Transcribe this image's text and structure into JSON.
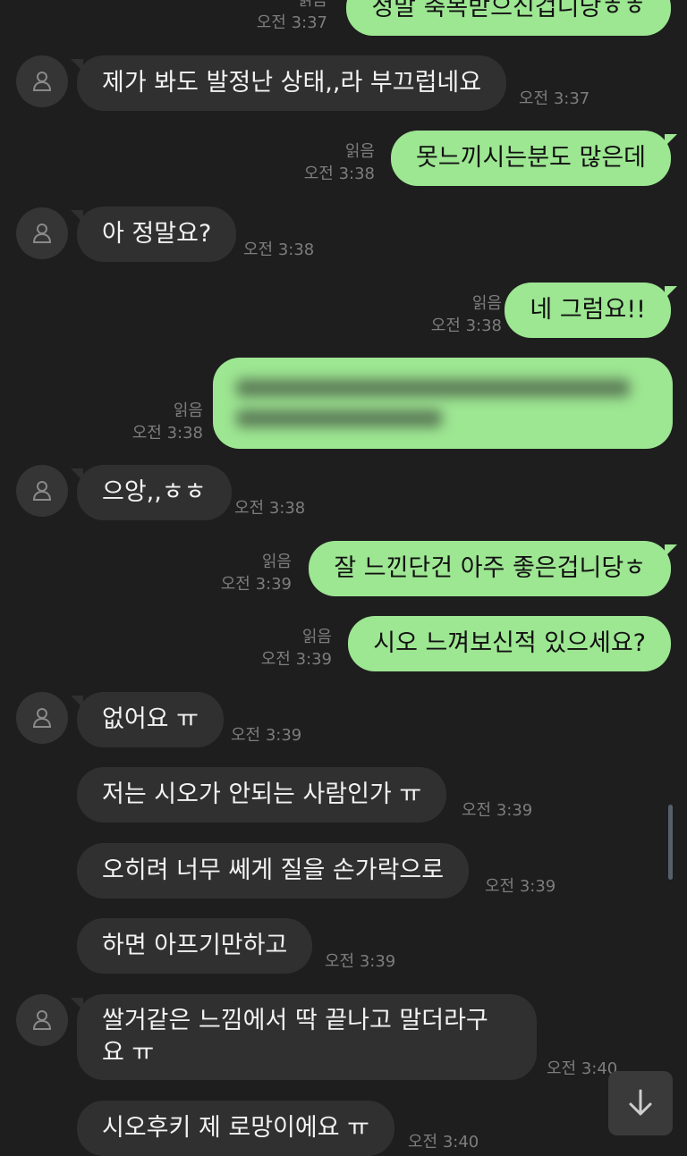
{
  "messages": [
    {
      "text": "정말 축복받으신겁니당ㅎㅎ",
      "read": "읽음",
      "time": "오전 3:37"
    },
    {
      "text": "제가 봐도 발정난 상태,,라 부끄럽네요",
      "time": "오전 3:37"
    },
    {
      "text": "못느끼시는분도 많은데",
      "read": "읽음",
      "time": "오전 3:38"
    },
    {
      "text": "아 정말요?",
      "time": "오전 3:38"
    },
    {
      "text": "네 그럼요!!",
      "read": "읽음",
      "time": "오전 3:38"
    },
    {
      "text": "",
      "read": "읽음",
      "time": "오전 3:38"
    },
    {
      "text": "으앙,,ㅎㅎ",
      "time": "오전 3:38"
    },
    {
      "text": "잘 느낀단건 아주 좋은겁니당ㅎ",
      "read": "읽음",
      "time": "오전 3:39"
    },
    {
      "text": "시오 느껴보신적 있으세요?",
      "read": "읽음",
      "time": "오전 3:39"
    },
    {
      "text": "없어요 ㅠ",
      "time": "오전 3:39"
    },
    {
      "text": "저는 시오가 안되는 사람인가 ㅠ",
      "time": "오전 3:39"
    },
    {
      "text": "오히려 너무 쎄게 질을 손가락으로",
      "time": "오전 3:39"
    },
    {
      "text": "하면 아프기만하고",
      "time": "오전 3:39"
    },
    {
      "text_line1": "쌀거같은 느낌에서 딱 끝나고 말더라구",
      "text_line2": "요 ㅠ",
      "time": "오전 3:40"
    },
    {
      "text": "시오후키 제 로망이에요 ㅠ",
      "time": "오전 3:40"
    }
  ],
  "icons": {
    "avatar": "person-outline-icon",
    "scroll_down": "arrow-down-icon"
  },
  "colors": {
    "background": "#1e1e1e",
    "incoming_bubble": "#303030",
    "outgoing_bubble": "#9de692",
    "timestamp": "#7d7d7d"
  }
}
